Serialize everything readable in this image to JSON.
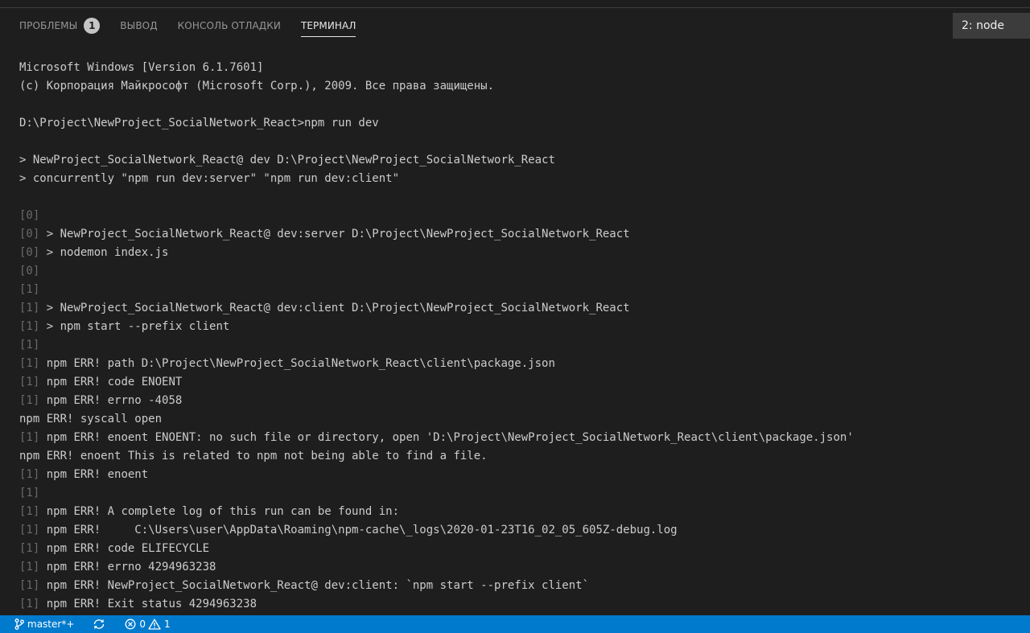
{
  "panel": {
    "tabs": [
      {
        "label": "ПРОБЛЕМЫ",
        "badge": "1"
      },
      {
        "label": "ВЫВОД"
      },
      {
        "label": "КОНСОЛЬ ОТЛАДКИ"
      },
      {
        "label": "ТЕРМИНАЛ",
        "active": true
      }
    ],
    "terminal_select": "2: node"
  },
  "terminal": {
    "lines": [
      {
        "text": "Microsoft Windows [Version 6.1.7601]"
      },
      {
        "text": "(c) Корпорация Майкрософт (Microsoft Corp.), 2009. Все права защищены."
      },
      {
        "text": ""
      },
      {
        "text": "D:\\Project\\NewProject_SocialNetwork_React>npm run dev"
      },
      {
        "text": ""
      },
      {
        "text": "> NewProject_SocialNetwork_React@ dev D:\\Project\\NewProject_SocialNetwork_React"
      },
      {
        "text": "> concurrently \"npm run dev:server\" \"npm run dev:client\""
      },
      {
        "text": ""
      },
      {
        "prefix": "[0]",
        "text": ""
      },
      {
        "prefix": "[0]",
        "text": " > NewProject_SocialNetwork_React@ dev:server D:\\Project\\NewProject_SocialNetwork_React"
      },
      {
        "prefix": "[0]",
        "text": " > nodemon index.js"
      },
      {
        "prefix": "[0]",
        "text": ""
      },
      {
        "prefix": "[1]",
        "text": ""
      },
      {
        "prefix": "[1]",
        "text": " > NewProject_SocialNetwork_React@ dev:client D:\\Project\\NewProject_SocialNetwork_React"
      },
      {
        "prefix": "[1]",
        "text": " > npm start --prefix client"
      },
      {
        "prefix": "[1]",
        "text": ""
      },
      {
        "prefix": "[1]",
        "text": " npm ERR! path D:\\Project\\NewProject_SocialNetwork_React\\client\\package.json"
      },
      {
        "prefix": "[1]",
        "text": " npm ERR! code ENOENT"
      },
      {
        "prefix": "[1]",
        "text": " npm ERR! errno -4058"
      },
      {
        "text": "npm ERR! syscall open"
      },
      {
        "prefix": "[1]",
        "text": " npm ERR! enoent ENOENT: no such file or directory, open 'D:\\Project\\NewProject_SocialNetwork_React\\client\\package.json'"
      },
      {
        "text": "npm ERR! enoent This is related to npm not being able to find a file."
      },
      {
        "prefix": "[1]",
        "text": " npm ERR! enoent"
      },
      {
        "prefix": "[1]",
        "text": ""
      },
      {
        "prefix": "[1]",
        "text": " npm ERR! A complete log of this run can be found in:"
      },
      {
        "prefix": "[1]",
        "text": " npm ERR!     C:\\Users\\user\\AppData\\Roaming\\npm-cache\\_logs\\2020-01-23T16_02_05_605Z-debug.log"
      },
      {
        "prefix": "[1]",
        "text": " npm ERR! code ELIFECYCLE"
      },
      {
        "prefix": "[1]",
        "text": " npm ERR! errno 4294963238"
      },
      {
        "prefix": "[1]",
        "text": " npm ERR! NewProject_SocialNetwork_React@ dev:client: `npm start --prefix client`"
      },
      {
        "prefix": "[1]",
        "text": " npm ERR! Exit status 4294963238"
      }
    ]
  },
  "status_bar": {
    "branch": "master*+",
    "errors": "0",
    "warnings": "1",
    "icons": [
      "git-branch-icon",
      "sync-icon",
      "error-icon",
      "warning-icon"
    ]
  },
  "colors": {
    "background": "#1e1e1e",
    "status_bar": "#007acc",
    "text": "#cccccc",
    "prefix": "#6a6a6a"
  }
}
